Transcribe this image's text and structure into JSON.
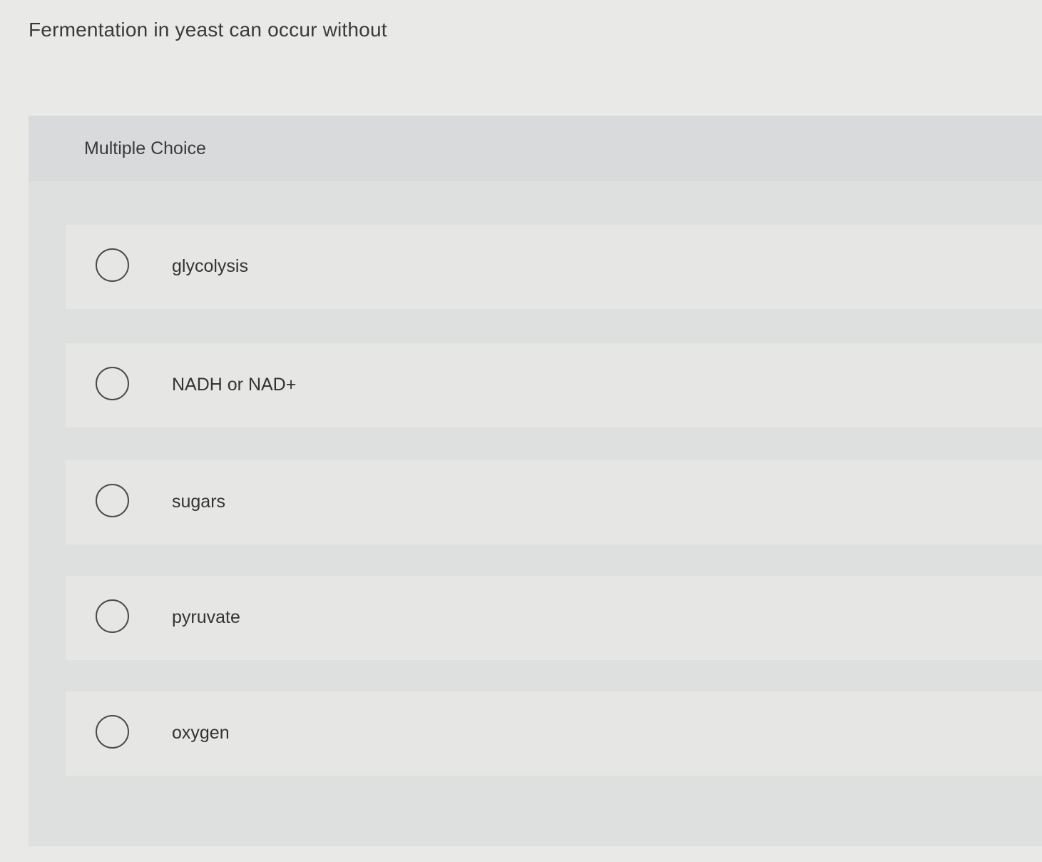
{
  "question": {
    "text": "Fermentation in yeast can occur without"
  },
  "panel": {
    "label": "Multiple Choice"
  },
  "options": [
    {
      "label": "glycolysis",
      "selected": false
    },
    {
      "label": "NADH or NAD+",
      "selected": false
    },
    {
      "label": "sugars",
      "selected": false
    },
    {
      "label": "pyruvate",
      "selected": false
    },
    {
      "label": "oxygen",
      "selected": false
    }
  ]
}
